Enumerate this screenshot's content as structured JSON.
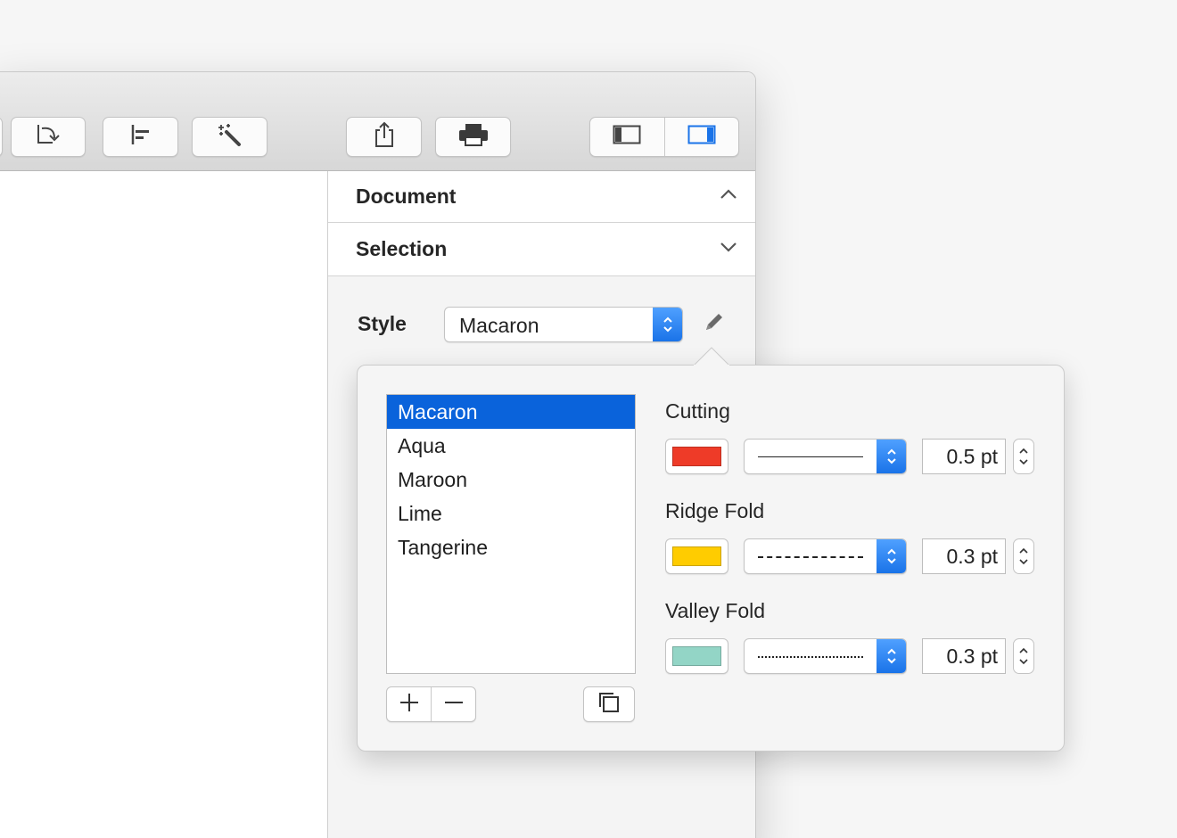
{
  "toolbar": {
    "buttons": [
      "rotate-icon",
      "align-left-icon",
      "magic-wand-icon",
      "share-icon",
      "print-icon"
    ],
    "view_toggle": [
      "sidebar-left-icon",
      "sidebar-right-icon"
    ]
  },
  "inspector": {
    "sections": [
      {
        "title": "Document",
        "state": "expanded"
      },
      {
        "title": "Selection",
        "state": "collapsed"
      }
    ],
    "style_label": "Style",
    "style_value": "Macaron",
    "edit_icon": "pencil-icon"
  },
  "popover": {
    "styles": [
      "Macaron",
      "Aqua",
      "Maroon",
      "Lime",
      "Tangerine"
    ],
    "selected_style": "Macaron",
    "list_buttons": [
      "add-icon",
      "remove-icon"
    ],
    "duplicate_icon": "duplicate-icon",
    "lines": [
      {
        "label": "Cutting",
        "color": "#ee3b28",
        "line_style": "solid",
        "weight": "0.5 pt"
      },
      {
        "label": "Ridge Fold",
        "color": "#ffcc00",
        "line_style": "dashed",
        "weight": "0.3 pt"
      },
      {
        "label": "Valley Fold",
        "color": "#93d5c6",
        "line_style": "dotted",
        "weight": "0.3 pt"
      }
    ]
  },
  "colors": {
    "accent": "#0a63db",
    "stepper": "#1a73e8"
  }
}
